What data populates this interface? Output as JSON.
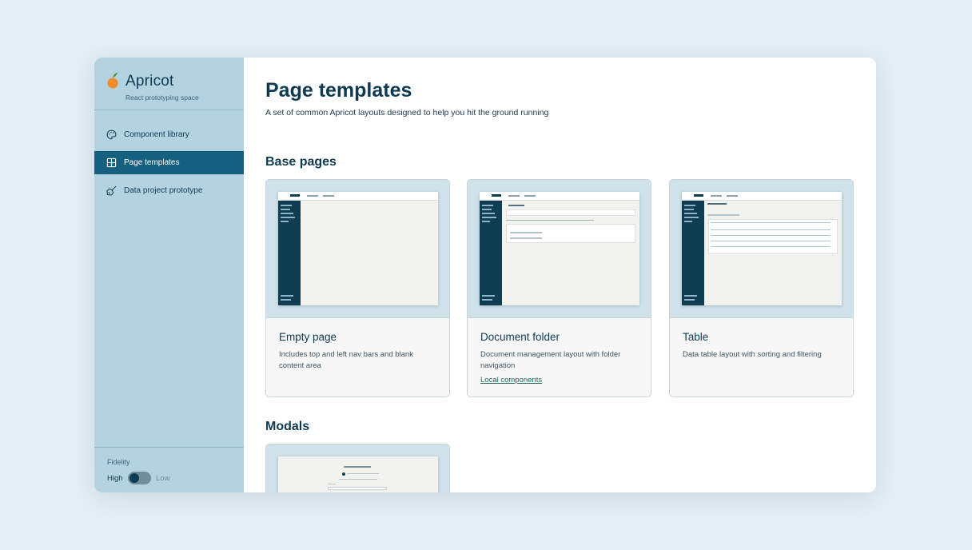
{
  "app": {
    "name": "Apricot",
    "tagline": "React prototyping space"
  },
  "sidebar": {
    "items": [
      {
        "label": "Component library",
        "icon": "palette-icon",
        "active": false
      },
      {
        "label": "Page templates",
        "icon": "grid-icon",
        "active": true
      },
      {
        "label": "Data project prototype",
        "icon": "broom-icon",
        "active": false
      }
    ],
    "fidelity": {
      "title": "Fidelity",
      "high_label": "High",
      "low_label": "Low",
      "value": "High"
    }
  },
  "main": {
    "title": "Page templates",
    "description": "A set of common Apricot layouts designed to help you hit the ground running",
    "sections": [
      {
        "title": "Base pages",
        "cards": [
          {
            "title": "Empty page",
            "description": "Includes top and left nav bars and blank content area",
            "link": ""
          },
          {
            "title": "Document folder",
            "description": "Document management layout with folder navigation",
            "link": "Local components"
          },
          {
            "title": "Table",
            "description": "Data table layout with sorting and filtering",
            "link": ""
          }
        ]
      },
      {
        "title": "Modals",
        "cards": [
          {
            "title": "",
            "description": "",
            "link": ""
          }
        ]
      }
    ]
  },
  "colors": {
    "sidebar_bg": "#b3d3e0",
    "active_nav": "#165f7e",
    "brand_text": "#0e3a52",
    "apricot_orange": "#f08c2a",
    "leaf_green": "#4c9a3a",
    "link_green": "#1e6a55"
  }
}
